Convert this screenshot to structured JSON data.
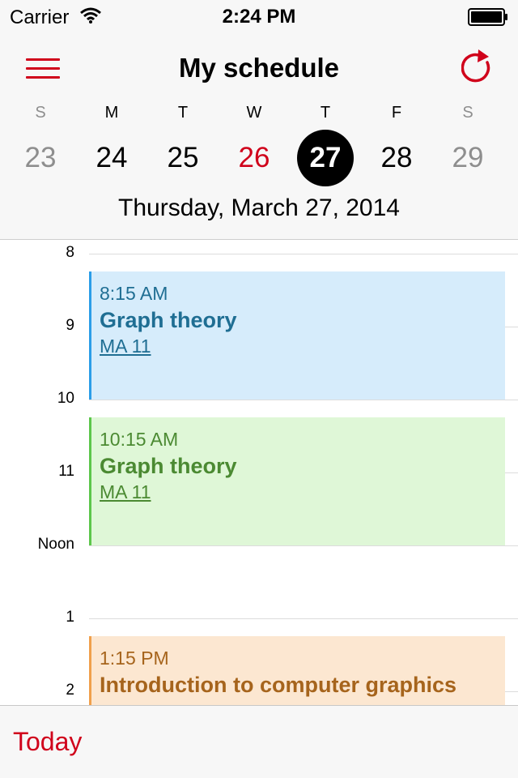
{
  "status_bar": {
    "carrier": "Carrier",
    "time": "2:24 PM"
  },
  "header": {
    "title": "My schedule",
    "full_date": "Thursday, March 27, 2014",
    "accent_color": "#d0021b"
  },
  "week": {
    "days": [
      {
        "name": "S",
        "date": "23"
      },
      {
        "name": "M",
        "date": "24"
      },
      {
        "name": "T",
        "date": "25"
      },
      {
        "name": "W",
        "date": "26"
      },
      {
        "name": "T",
        "date": "27"
      },
      {
        "name": "F",
        "date": "28"
      },
      {
        "name": "S",
        "date": "29"
      }
    ]
  },
  "timeline": {
    "hours": [
      "8",
      "9",
      "10",
      "11",
      "Noon",
      "1",
      "2"
    ],
    "events": [
      {
        "time": "8:15 AM",
        "title": "Graph theory",
        "room": "MA 11",
        "color": "#d6ecfb"
      },
      {
        "time": "10:15 AM",
        "title": "Graph theory",
        "room": "MA 11",
        "color": "#dff7d7"
      },
      {
        "time": "1:15 PM",
        "title": "Introduction to computer graphics",
        "color": "#fce7d1"
      }
    ]
  },
  "toolbar": {
    "today_label": "Today"
  }
}
